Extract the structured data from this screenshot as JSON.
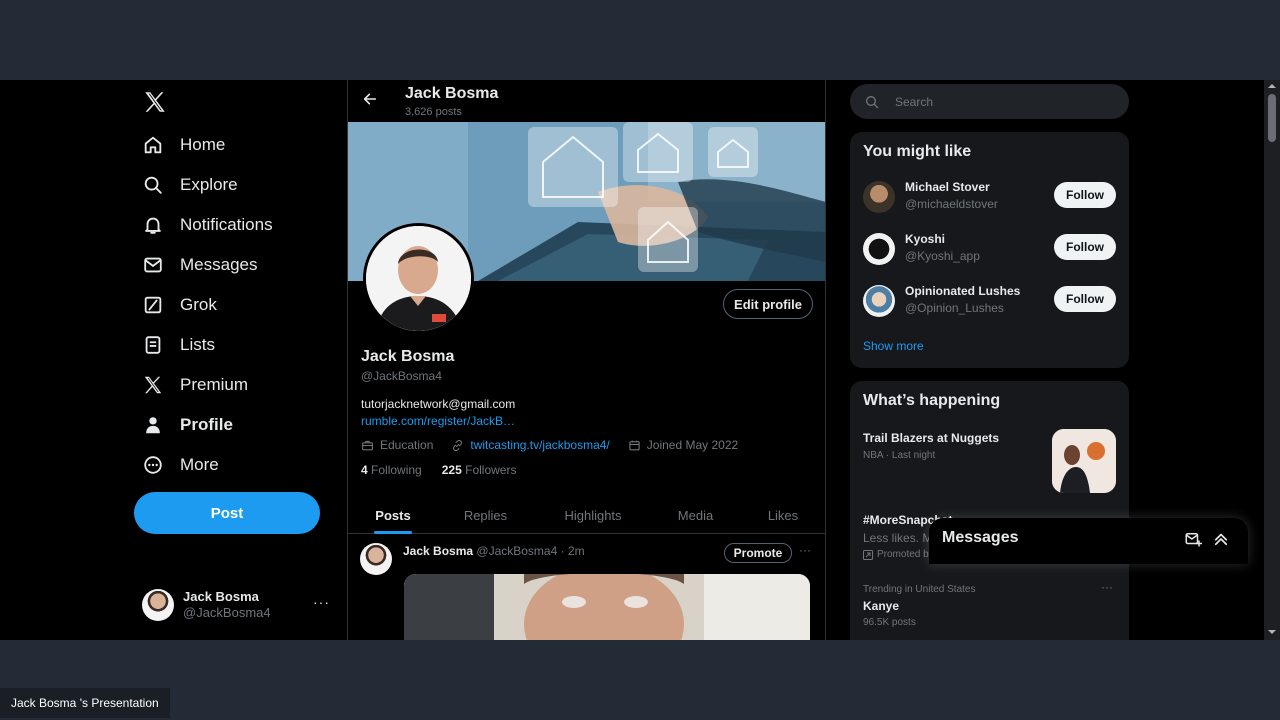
{
  "nav": {
    "items": [
      {
        "label": "Home",
        "icon": "home-icon"
      },
      {
        "label": "Explore",
        "icon": "search-icon"
      },
      {
        "label": "Notifications",
        "icon": "bell-icon"
      },
      {
        "label": "Messages",
        "icon": "envelope-icon"
      },
      {
        "label": "Grok",
        "icon": "grok-icon"
      },
      {
        "label": "Lists",
        "icon": "list-icon"
      },
      {
        "label": "Premium",
        "icon": "x-logo-icon"
      },
      {
        "label": "Profile",
        "icon": "person-icon"
      },
      {
        "label": "More",
        "icon": "more-circle-icon"
      }
    ],
    "post_label": "Post",
    "account": {
      "name": "Jack Bosma",
      "handle": "@JackBosma4",
      "more": "···"
    }
  },
  "profile": {
    "header_name": "Jack Bosma",
    "post_count": "3,626 posts",
    "edit_label": "Edit profile",
    "name": "Jack Bosma",
    "handle": "@JackBosma4",
    "bio_line1": "tutorjacknetwork@gmail.com",
    "bio_line2": "rumble.com/register/JackB…",
    "category": "Education",
    "website": "twitcasting.tv/jackbosma4/",
    "joined": "Joined May 2022",
    "following_count": "4",
    "following_label": "Following",
    "followers_count": "225",
    "followers_label": "Followers",
    "tabs": [
      "Posts",
      "Replies",
      "Highlights",
      "Media",
      "Likes"
    ]
  },
  "tweet": {
    "name": "Jack Bosma",
    "meta": "@JackBosma4 · 2m",
    "promote_label": "Promote",
    "more": "···"
  },
  "right": {
    "search_placeholder": "Search",
    "suggestions_title": "You might like",
    "suggestions": [
      {
        "name": "Michael Stover",
        "handle": "@michaeldstover",
        "button": "Follow"
      },
      {
        "name": "Kyoshi",
        "handle": "@Kyoshi_app",
        "button": "Follow"
      },
      {
        "name": "Opinionated Lushes",
        "handle": "@Opinion_Lushes",
        "button": "Follow"
      }
    ],
    "show_more": "Show more",
    "happening_title": "What’s happening",
    "trends": [
      {
        "title": "Trail Blazers at Nuggets",
        "sub": "NBA · Last night"
      },
      {
        "title": "#MoreSnapchat",
        "desc": "Less likes. More love. Try Snapchat.",
        "sub": "Promoted by Snapchat"
      },
      {
        "context": "Trending in United States",
        "title": "Kanye",
        "sub": "96.5K posts",
        "more": "···"
      }
    ]
  },
  "messages_dock": {
    "title": "Messages"
  },
  "caption": "Jack Bosma 's Presentation",
  "colors": {
    "accent": "#1d9bf0",
    "background": "#000000",
    "card": "#16181c",
    "muted": "#71767b"
  }
}
